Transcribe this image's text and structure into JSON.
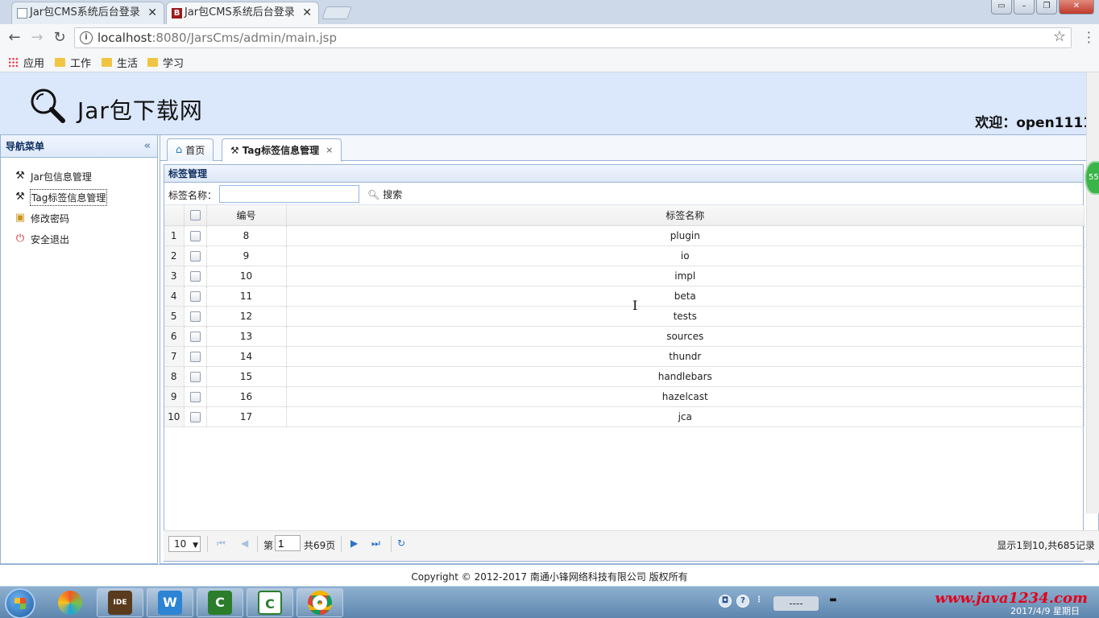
{
  "browser": {
    "tabs": [
      {
        "title": "Jar包CMS系统后台登录"
      },
      {
        "title": "Jar包CMS系统后台登录"
      }
    ],
    "active_favicon": "B",
    "url_host": "localhost",
    "url_rest": ":8080/JarsCms/admin/main.jsp",
    "bookmarks": [
      "应用",
      "工作",
      "生活",
      "学习"
    ]
  },
  "header": {
    "site_title": "Jar包下载网",
    "welcome_label": "欢迎：",
    "username": "open1111"
  },
  "sidebar": {
    "title": "导航菜单",
    "items": [
      {
        "label": "Jar包信息管理",
        "icon": "tools-icon"
      },
      {
        "label": "Tag标签信息管理",
        "icon": "tools-icon",
        "selected": true
      },
      {
        "label": "修改密码",
        "icon": "password-icon"
      },
      {
        "label": "安全退出",
        "icon": "exit-icon"
      }
    ]
  },
  "content_tabs": {
    "home": "首页",
    "active": "Tag标签信息管理"
  },
  "panel": {
    "title": "标签管理",
    "search_label": "标签名称：",
    "search_value": "",
    "search_button": "搜索"
  },
  "table": {
    "columns": [
      "编号",
      "标签名称"
    ],
    "rows": [
      {
        "n": "1",
        "id": "8",
        "name": "plugin"
      },
      {
        "n": "2",
        "id": "9",
        "name": "io"
      },
      {
        "n": "3",
        "id": "10",
        "name": "impl"
      },
      {
        "n": "4",
        "id": "11",
        "name": "beta"
      },
      {
        "n": "5",
        "id": "12",
        "name": "tests"
      },
      {
        "n": "6",
        "id": "13",
        "name": "sources"
      },
      {
        "n": "7",
        "id": "14",
        "name": "thundr"
      },
      {
        "n": "8",
        "id": "15",
        "name": "handlebars"
      },
      {
        "n": "9",
        "id": "16",
        "name": "hazelcast"
      },
      {
        "n": "10",
        "id": "17",
        "name": "jca"
      }
    ]
  },
  "pager": {
    "page_size": "10",
    "page_label_before": "第",
    "current_page": "1",
    "page_label_after": "共69页",
    "summary": "显示1到10,共685记录"
  },
  "footer": {
    "copyright": "Copyright © 2012-2017 南通小锋网络科技有限公司 版权所有"
  },
  "taskbar": {
    "watermark": "www.java1234.com",
    "clock": "2017/4/9 星期日",
    "lang": "----"
  },
  "scroll_badge": "55"
}
